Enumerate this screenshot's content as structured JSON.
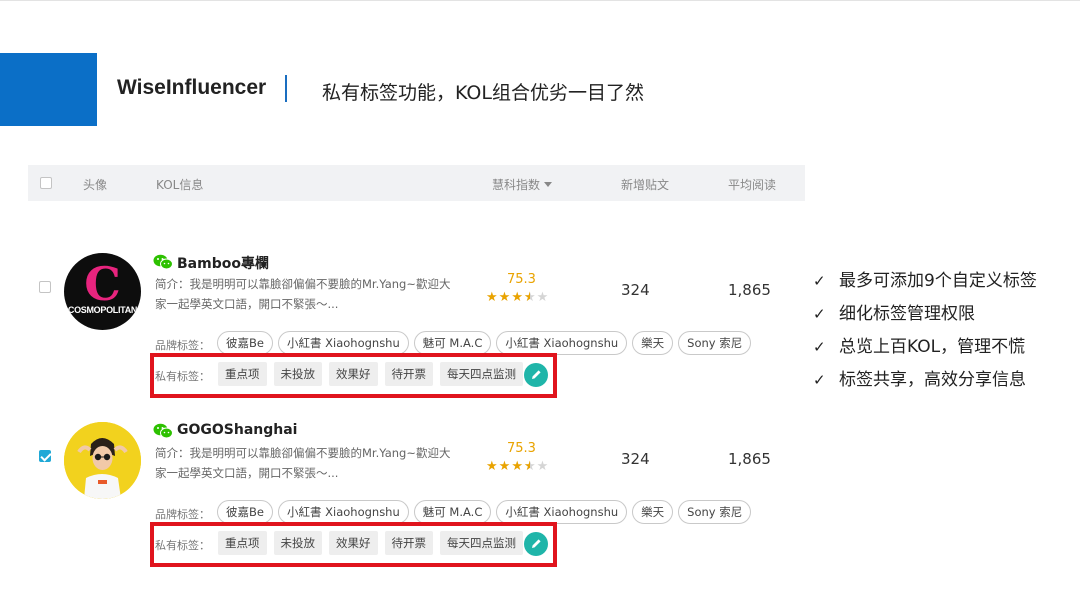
{
  "header": {
    "brand": "WiseInfluencer",
    "headline": "私有标签功能，KOL组合优劣一目了然"
  },
  "table": {
    "columns": {
      "avatar": "头像",
      "kol_info": "KOL信息",
      "index": "慧科指数",
      "new_posts": "新增贴文",
      "avg_reads": "平均阅读"
    },
    "brand_tags_label": "品牌标签：",
    "private_tags_label": "私有标签：",
    "rows": [
      {
        "checked": false,
        "avatar_text_c": "C",
        "avatar_text_cosmo": "COSMOPOLITAN",
        "name": "Bamboo專欄",
        "bio": "简介：我是明明可以靠臉卻偏偏不要臉的Mr.Yang~歡迎大家一起學英文口語，開口不緊張～...",
        "score": "75.3",
        "stars": 3.5,
        "new_posts": "324",
        "avg_reads": "1,865",
        "brand_tags": [
          "彼嘉Be",
          "小紅書 Xiaohognshu",
          "魅可 M.A.C",
          "小紅書 Xiaohognshu",
          "樂天",
          "Sony 索尼"
        ],
        "private_tags": [
          "重点项",
          "未投放",
          "效果好",
          "待开票",
          "每天四点监测"
        ]
      },
      {
        "checked": true,
        "name": "GOGOShanghai",
        "bio": "简介：我是明明可以靠臉卻偏偏不要臉的Mr.Yang~歡迎大家一起學英文口語，開口不緊張～...",
        "score": "75.3",
        "stars": 3.5,
        "new_posts": "324",
        "avg_reads": "1,865",
        "brand_tags": [
          "彼嘉Be",
          "小紅書 Xiaohognshu",
          "魅可 M.A.C",
          "小紅書 Xiaohognshu",
          "樂天",
          "Sony 索尼"
        ],
        "private_tags": [
          "重点项",
          "未投放",
          "效果好",
          "待开票",
          "每天四点监测"
        ]
      }
    ]
  },
  "features": [
    "最多可添加9个自定义标签",
    "细化标签管理权限",
    "总览上百KOL，管理不慌",
    "标签共享，高效分享信息"
  ],
  "colors": {
    "brand_blue": "#0b6fc7",
    "highlight_red": "#e0141d",
    "score_gold": "#e9a300",
    "accent_teal": "#1fb5a9",
    "checkbox_blue": "#1fa8d6",
    "wechat_green": "#2dc100"
  },
  "icons": {
    "wechat": "wechat-icon",
    "edit": "pencil-icon",
    "sort": "caret-down-icon",
    "check": "check-icon"
  }
}
